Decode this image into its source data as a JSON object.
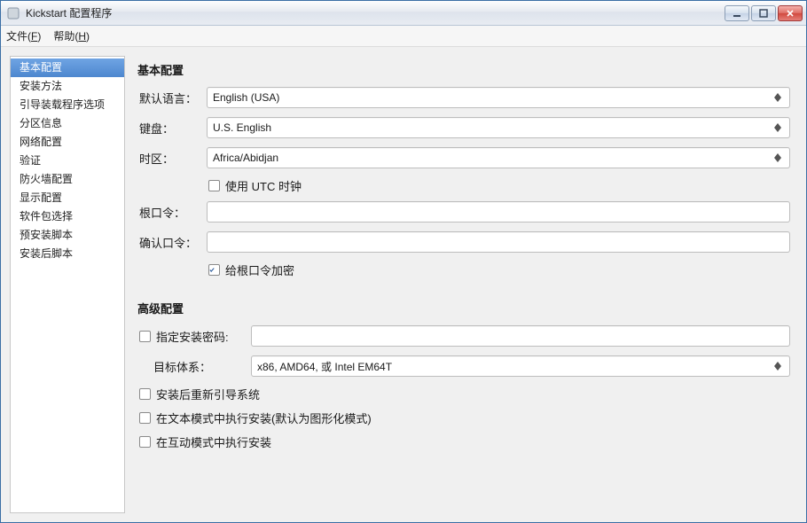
{
  "window": {
    "title": "Kickstart 配置程序"
  },
  "menubar": {
    "file": {
      "label": "文件",
      "accel": "F"
    },
    "help": {
      "label": "帮助",
      "accel": "H"
    }
  },
  "sidebar": {
    "items": [
      {
        "label": "基本配置",
        "selected": true
      },
      {
        "label": "安装方法"
      },
      {
        "label": "引导装载程序选项"
      },
      {
        "label": "分区信息"
      },
      {
        "label": "网络配置"
      },
      {
        "label": "验证"
      },
      {
        "label": "防火墙配置"
      },
      {
        "label": "显示配置"
      },
      {
        "label": "软件包选择"
      },
      {
        "label": "预安装脚本"
      },
      {
        "label": "安装后脚本"
      }
    ]
  },
  "basic": {
    "section_title": "基本配置",
    "language": {
      "label": "默认语言：",
      "value": "English (USA)"
    },
    "keyboard": {
      "label": "键盘：",
      "value": "U.S. English"
    },
    "timezone": {
      "label": "时区：",
      "value": "Africa/Abidjan"
    },
    "utc": {
      "label": "使用 UTC 时钟",
      "checked": false
    },
    "root_pw": {
      "label": "根口令：",
      "value": ""
    },
    "confirm_pw": {
      "label": "确认口令：",
      "value": ""
    },
    "encrypt": {
      "label": "给根口令加密",
      "checked": true
    }
  },
  "advanced": {
    "section_title": "高级配置",
    "install_key": {
      "label": "指定安装密码:",
      "checked": false,
      "value": ""
    },
    "target_arch": {
      "label": "目标体系：",
      "value": "x86, AMD64, 或 Intel EM64T"
    },
    "reboot": {
      "label": "安装后重新引导系统",
      "checked": false
    },
    "textmode": {
      "label": "在文本模式中执行安装(默认为图形化模式)",
      "checked": false
    },
    "interactive": {
      "label": "在互动模式中执行安装",
      "checked": false
    }
  }
}
